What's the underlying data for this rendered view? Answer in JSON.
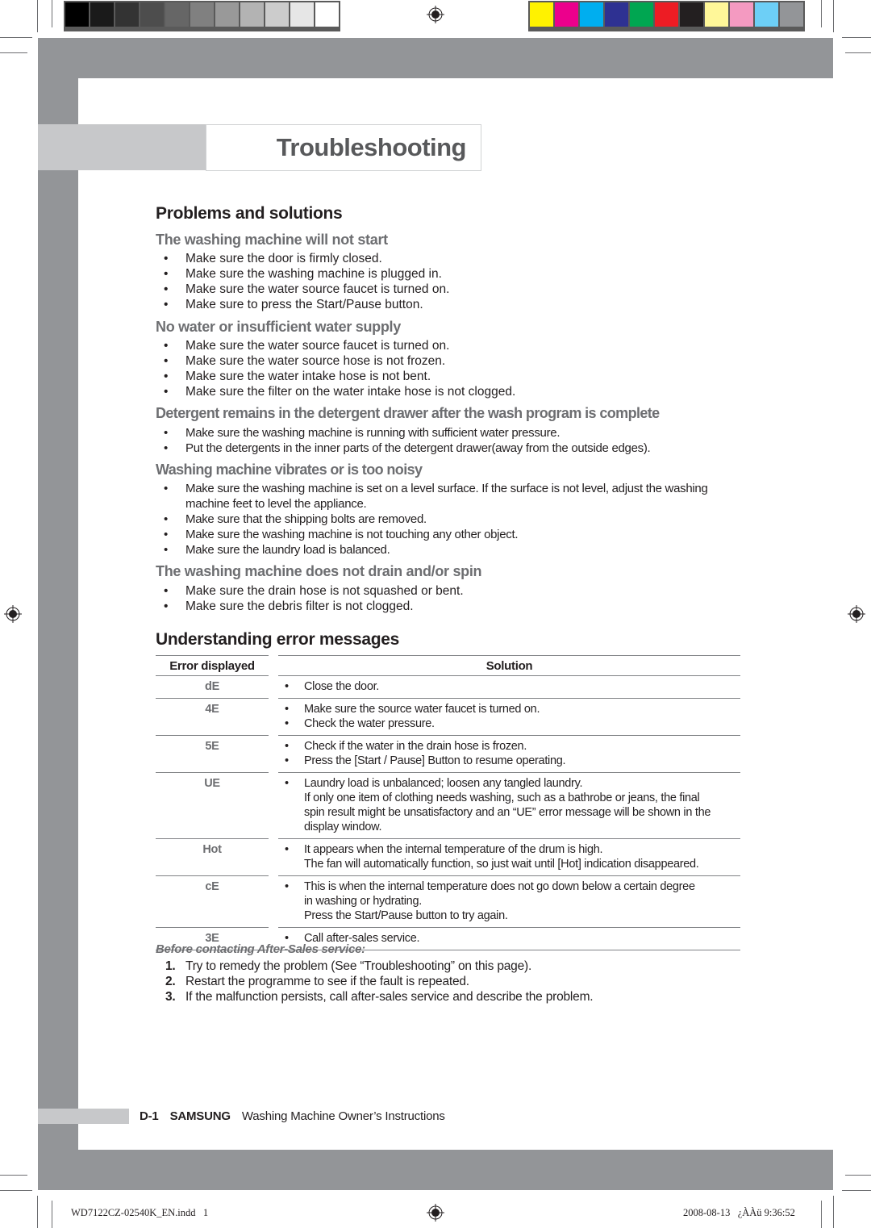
{
  "print_marks": {
    "gray_swatches": [
      "#000000",
      "#1a1a1a",
      "#333333",
      "#4d4d4d",
      "#666666",
      "#808080",
      "#999999",
      "#b3b3b3",
      "#cccccc",
      "#e6e6e6",
      "#ffffff"
    ],
    "color_swatches": [
      "#fff200",
      "#ec008c",
      "#00aeef",
      "#2e3192",
      "#00a651",
      "#ed1c24",
      "#231f20",
      "#fff799",
      "#f49ac1",
      "#6dcff6",
      "#939598"
    ]
  },
  "header": {
    "title": "Troubleshooting"
  },
  "problems": {
    "heading": "Problems and solutions",
    "sections": [
      {
        "title": "The washing machine will not start",
        "items": [
          "Make sure the door is firmly closed.",
          "Make sure the washing machine is plugged in.",
          "Make sure the water source faucet is turned on.",
          "Make sure to press the Start/Pause button."
        ]
      },
      {
        "title": "No water or insufficient water supply",
        "items": [
          "Make sure the water source faucet is turned on.",
          "Make sure the water source hose is not frozen.",
          "Make sure the water intake hose is not bent.",
          "Make sure the filter on the water intake hose is not clogged."
        ]
      },
      {
        "title": "Detergent remains in the detergent drawer after the wash program is complete",
        "items": [
          "Make sure the washing machine is running with sufficient water pressure.",
          "Put the detergents in the inner parts of the detergent drawer(away from the outside edges)."
        ]
      },
      {
        "title": "Washing machine vibrates or is too noisy",
        "items": [
          "Make sure the washing machine is set on a level surface. If the surface is not level, adjust the washing machine feet to level the appliance.",
          "Make sure that the shipping bolts are removed.",
          "Make sure the washing machine is not touching any other object.",
          "Make sure the laundry load is balanced."
        ]
      },
      {
        "title": "The washing machine does not drain and/or spin",
        "items": [
          "Make sure the drain hose is not squashed or bent.",
          "Make sure the debris filter is not clogged."
        ]
      }
    ]
  },
  "errors": {
    "heading": "Understanding error messages",
    "col_error": "Error displayed",
    "col_solution": "Solution",
    "rows": [
      {
        "code": "dE",
        "lines": [
          {
            "b": true,
            "t": "Close the door."
          }
        ]
      },
      {
        "code": "4E",
        "lines": [
          {
            "b": true,
            "t": "Make sure the source water faucet is turned on."
          },
          {
            "b": true,
            "t": "Check the water pressure."
          }
        ]
      },
      {
        "code": "5E",
        "lines": [
          {
            "b": true,
            "t": "Check if the water in the drain hose is frozen."
          },
          {
            "b": true,
            "t": "Press the [Start / Pause] Button to resume operating."
          }
        ]
      },
      {
        "code": "UE",
        "lines": [
          {
            "b": true,
            "t": "Laundry load is unbalanced; loosen any tangled laundry."
          },
          {
            "b": false,
            "t": "If only one item of clothing needs washing, such as a bathrobe or jeans, the final"
          },
          {
            "b": false,
            "t": "spin result might be unsatisfactory and an “UE” error message will be shown in the"
          },
          {
            "b": false,
            "t": "display window."
          }
        ]
      },
      {
        "code": "Hot",
        "lines": [
          {
            "b": true,
            "t": "It appears when the internal temperature of the drum is high."
          },
          {
            "b": false,
            "t": "The fan will automatically function, so just wait until [Hot] indication disappeared."
          }
        ]
      },
      {
        "code": "cE",
        "lines": [
          {
            "b": true,
            "t": "This is when the internal temperature does not go down below a certain degree"
          },
          {
            "b": false,
            "t": "in washing or hydrating."
          },
          {
            "b": false,
            "t": "Press the Start/Pause button to try again."
          }
        ]
      },
      {
        "code": "3E",
        "lines": [
          {
            "b": true,
            "t": "Call after-sales service."
          }
        ]
      }
    ]
  },
  "before_service": {
    "title": "Before contacting After-Sales service:",
    "steps": [
      {
        "num": "1.",
        "text": " Try to remedy the problem (See “Troubleshooting” on this page)."
      },
      {
        "num": "2.",
        "text": "Restart the programme to see if the fault is repeated."
      },
      {
        "num": "3.",
        "text": "If the malfunction persists, call after-sales service and describe the problem."
      }
    ]
  },
  "footer": {
    "page": "D-1",
    "brand": "SAMSUNG",
    "doc": "Washing Machine Owner’s Instructions"
  },
  "slug": {
    "file": "WD7122CZ-02540K_EN.indd   1",
    "datetime": "2008-08-13   ¿ÀÀü 9:36:52"
  }
}
